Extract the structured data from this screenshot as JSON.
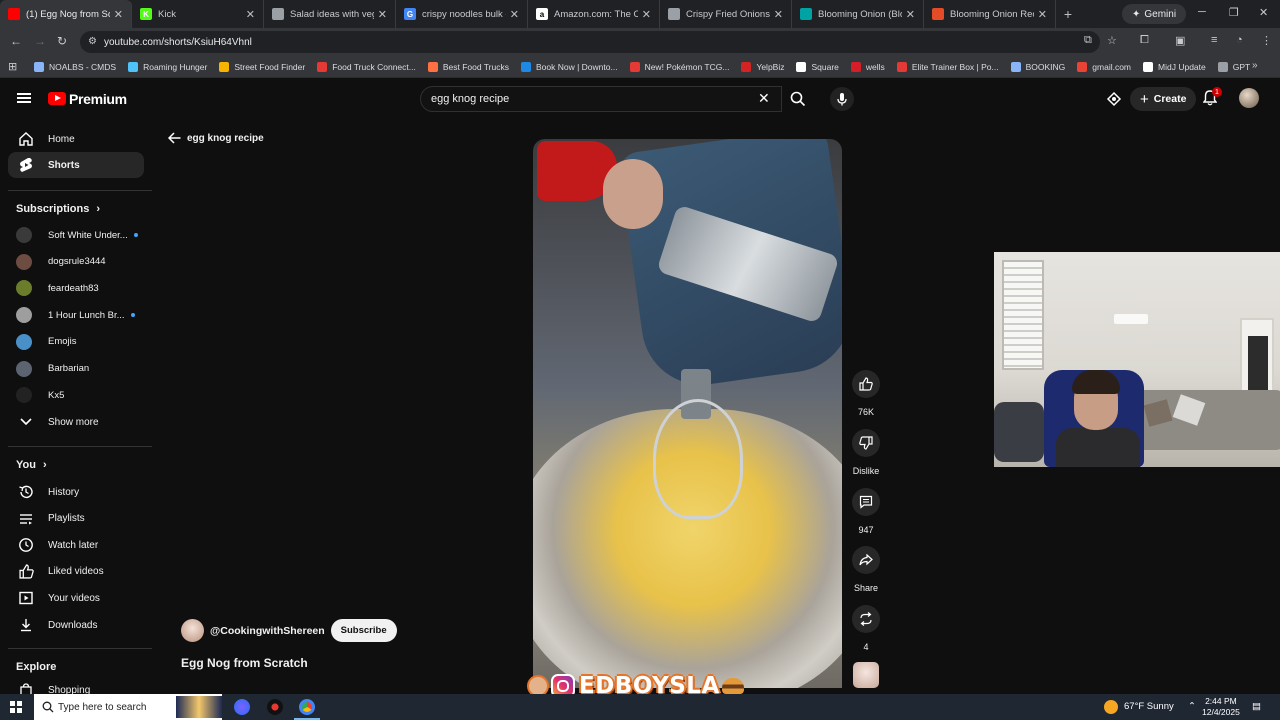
{
  "browser": {
    "tabs": [
      {
        "title": "(1) Egg Nog from Sc",
        "favicon_color": "#ff0000",
        "glyph": "",
        "active": true
      },
      {
        "title": "Kick",
        "favicon_color": "#53fc18",
        "glyph": "K",
        "active": false
      },
      {
        "title": "Salad ideas with vegeta",
        "favicon_color": "#9aa0a6",
        "glyph": "",
        "active": false
      },
      {
        "title": "crispy noodles bulk - Go",
        "favicon_color": "#4285f4",
        "glyph": "G",
        "active": false
      },
      {
        "title": "Amazon.com: The Origi",
        "favicon_color": "#ffffff",
        "glyph": "a",
        "active": false
      },
      {
        "title": "Crispy Fried Onions",
        "favicon_color": "#9aa0a6",
        "glyph": "",
        "active": false
      },
      {
        "title": "Blooming Onion (Bloom",
        "favicon_color": "#00a3a3",
        "glyph": "",
        "active": false
      },
      {
        "title": "Blooming Onion Recipe",
        "favicon_color": "#e34c26",
        "glyph": "",
        "active": false
      }
    ],
    "gemini_label": "Gemini",
    "url": "youtube.com/shorts/KsiuH64Vhnl",
    "bookmarks": [
      {
        "label": "NOALBS - CMDS",
        "color": "#8ab4f8"
      },
      {
        "label": "Roaming Hunger",
        "color": "#4fc3f7"
      },
      {
        "label": "Street Food Finder",
        "color": "#f4b400"
      },
      {
        "label": "Food Truck Connect...",
        "color": "#e53935"
      },
      {
        "label": "Best Food Trucks",
        "color": "#ff7043"
      },
      {
        "label": "Book Now | Downto...",
        "color": "#1e88e5"
      },
      {
        "label": "New! Pokémon TCG...",
        "color": "#e53935"
      },
      {
        "label": "YelpBiz",
        "color": "#d32323"
      },
      {
        "label": "Square",
        "color": "#ffffff"
      },
      {
        "label": "wells",
        "color": "#d71e28"
      },
      {
        "label": "Elite Trainer Box | Po...",
        "color": "#e53935"
      },
      {
        "label": "BOOKING",
        "color": "#8ab4f8"
      },
      {
        "label": "gmail.com",
        "color": "#ea4335"
      },
      {
        "label": "MidJ Update",
        "color": "#ffffff"
      },
      {
        "label": "GPT",
        "color": "#9aa0a6"
      }
    ]
  },
  "yt": {
    "logo_text": "Premium",
    "search_value": "egg knog recipe",
    "create_label": "Create",
    "notif_count": "1"
  },
  "sidebar": {
    "main": [
      {
        "label": "Home",
        "icon": "home-icon"
      },
      {
        "label": "Shorts",
        "icon": "shorts-icon",
        "selected": true
      }
    ],
    "subscriptions_title": "Subscriptions",
    "subscriptions": [
      {
        "name": "Soft White Under...",
        "color": "#3a3a3a",
        "new": true
      },
      {
        "name": "dogsrule3444",
        "color": "#6d4c41",
        "new": false
      },
      {
        "name": "feardeath83",
        "color": "#6b7d2a",
        "new": false
      },
      {
        "name": "1 Hour Lunch Br...",
        "color": "#9e9e9e",
        "new": true
      },
      {
        "name": "Emojis",
        "color": "#4a90c8",
        "new": false
      },
      {
        "name": "Barbarian",
        "color": "#5b6470",
        "new": false
      },
      {
        "name": "Kx5",
        "color": "#222222",
        "new": false
      }
    ],
    "show_more": "Show more",
    "you_title": "You",
    "you_items": [
      {
        "label": "History",
        "icon": "history-icon"
      },
      {
        "label": "Playlists",
        "icon": "playlists-icon"
      },
      {
        "label": "Watch later",
        "icon": "watch-later-icon"
      },
      {
        "label": "Liked videos",
        "icon": "liked-videos-icon"
      },
      {
        "label": "Your videos",
        "icon": "your-videos-icon"
      },
      {
        "label": "Downloads",
        "icon": "downloads-icon"
      }
    ],
    "explore_title": "Explore",
    "explore_items": [
      {
        "label": "Shopping"
      }
    ]
  },
  "main": {
    "back_label": "egg knog recipe",
    "channel": "@CookingwithShereen",
    "subscribe": "Subscribe",
    "title": "Egg Nog from Scratch",
    "actions": {
      "likes": "76K",
      "dislike": "Dislike",
      "comments": "947",
      "share": "Share",
      "remix": "4"
    }
  },
  "overlay": {
    "text": "EDBOYSLA"
  },
  "taskbar": {
    "search_placeholder": "Type here to search",
    "weather": "67°F  Sunny",
    "time": "2:44 PM",
    "date": "12/4/2025"
  }
}
